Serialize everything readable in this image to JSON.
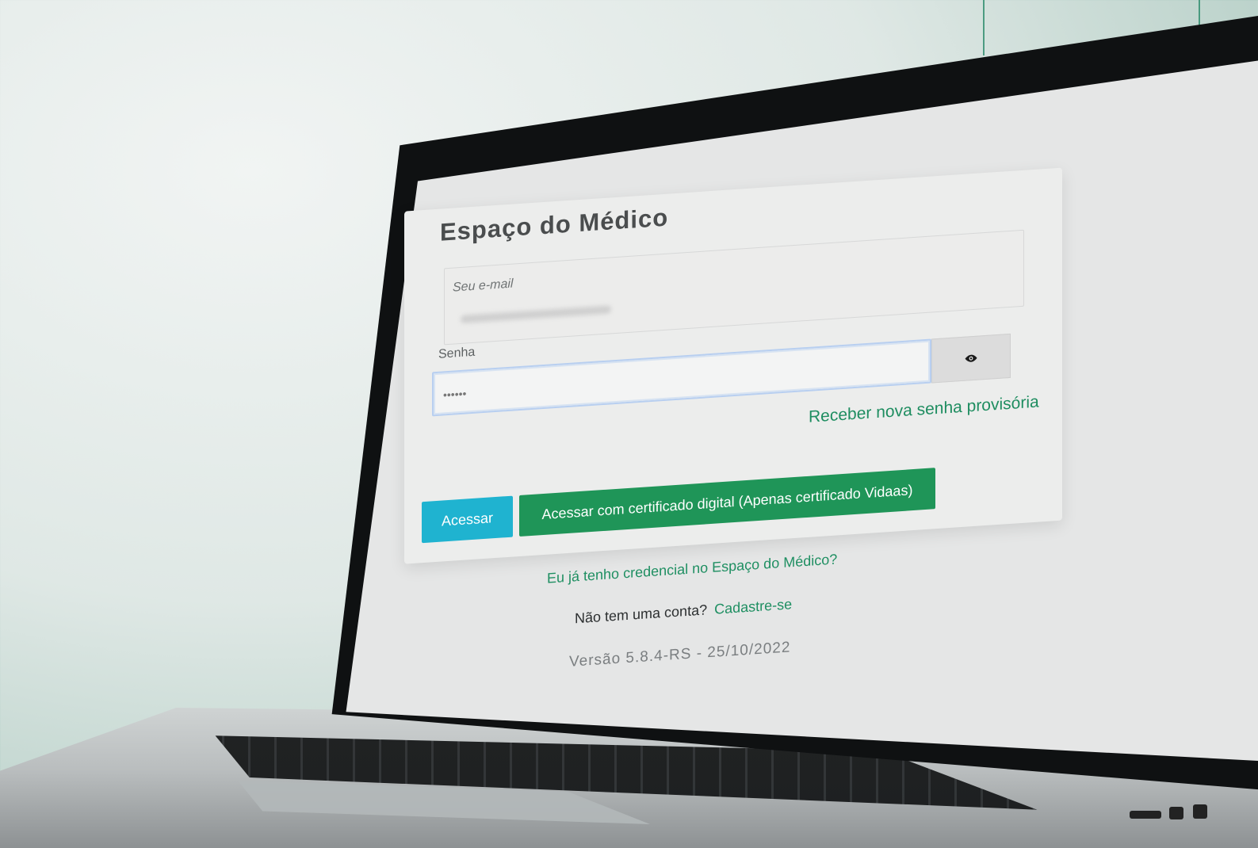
{
  "login": {
    "title": "Espaço do Médico",
    "email": {
      "label": "Seu e-mail",
      "value_masked": ""
    },
    "password": {
      "label": "Senha",
      "value": "••••••"
    },
    "show_password_icon": "eye-icon",
    "new_password_link": "Receber nova senha provisória",
    "buttons": {
      "access": "Acessar",
      "certificate": "Acessar com certificado digital (Apenas certificado Vidaas)"
    }
  },
  "footer": {
    "credential_link": "Eu já tenho credencial no Espaço do Médico?",
    "no_account_text": "Não tem uma conta?",
    "signup_link": "Cadastre-se",
    "version": "Versão 5.8.4-RS - 25/10/2022"
  },
  "colors": {
    "accent_green": "#1f9558",
    "accent_cyan": "#1fb3d0",
    "link_green": "#1f8f62",
    "focus_blue": "#b8cff0"
  }
}
